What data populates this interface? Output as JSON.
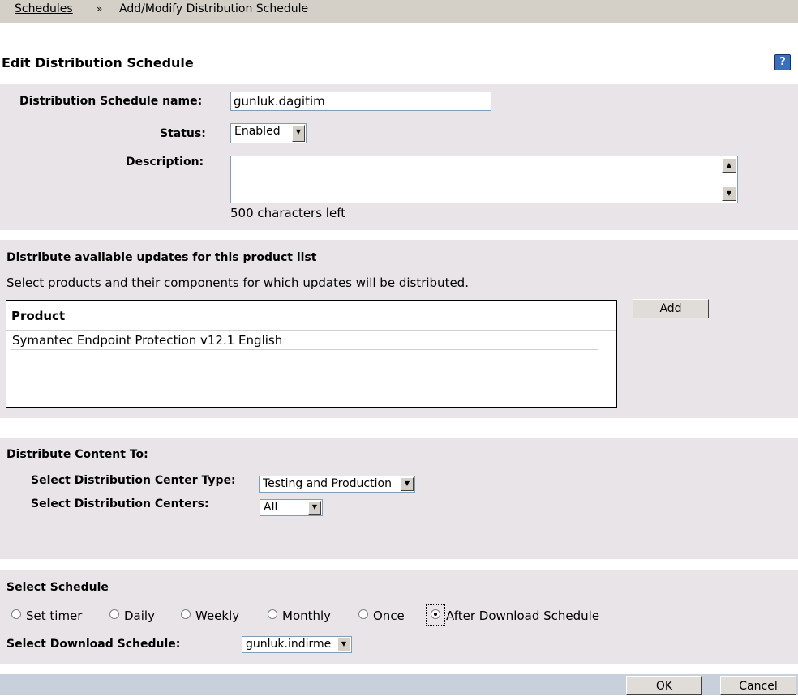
{
  "breadcrumb": {
    "link": "Schedules",
    "separator": "»",
    "current": "Add/Modify Distribution Schedule"
  },
  "page_title": "Edit Distribution Schedule",
  "help_icon": "question-mark-icon",
  "form": {
    "name_label": "Distribution Schedule name:",
    "name_value": "gunluk.dagitim",
    "status_label": "Status:",
    "status_value": "Enabled",
    "description_label": "Description:",
    "description_value": "",
    "chars_left": "500 characters left"
  },
  "products": {
    "heading": "Distribute available updates for this product list",
    "subtext": "Select products and their components for which updates will be distributed.",
    "column_header": "Product",
    "rows": [
      "Symantec Endpoint Protection v12.1 English"
    ],
    "add_label": "Add"
  },
  "distribute": {
    "heading": "Distribute Content To:",
    "center_type_label": "Select Distribution Center Type:",
    "center_type_value": "Testing and Production",
    "centers_label": "Select Distribution Centers:",
    "centers_value": "All"
  },
  "schedule": {
    "heading": "Select Schedule",
    "options": [
      "Set timer",
      "Daily",
      "Weekly",
      "Monthly",
      "Once",
      "After Download Schedule"
    ],
    "selected": "After Download Schedule",
    "download_label": "Select Download Schedule:",
    "download_value": "gunluk.indirme"
  },
  "footer": {
    "ok_label": "OK",
    "cancel_label": "Cancel"
  }
}
